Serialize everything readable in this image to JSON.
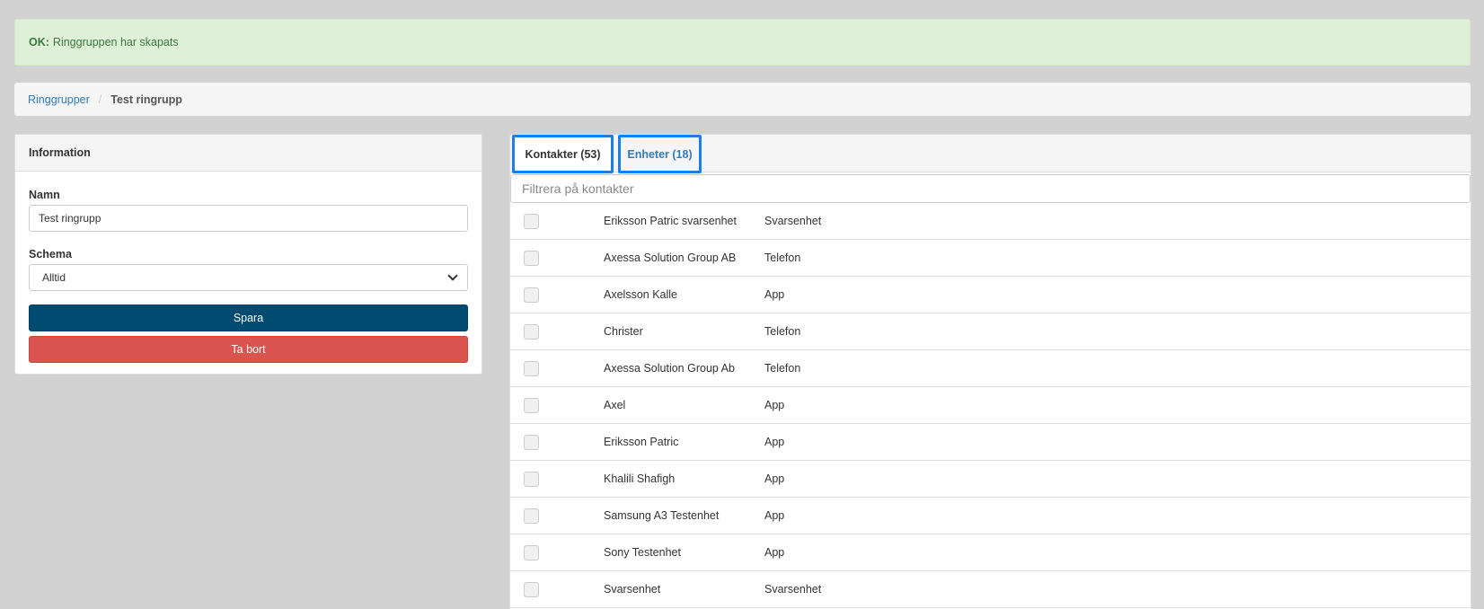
{
  "alert": {
    "prefix": "OK:",
    "message": "Ringgruppen har skapats"
  },
  "breadcrumb": {
    "parent": "Ringgrupper",
    "separator": "/",
    "current": "Test ringrupp"
  },
  "info_panel": {
    "title": "Information",
    "name_label": "Namn",
    "name_value": "Test ringrupp",
    "schedule_label": "Schema",
    "schedule_value": "Alltid",
    "save_label": "Spara",
    "delete_label": "Ta bort"
  },
  "tabs": [
    {
      "label": "Kontakter (53)",
      "active": true
    },
    {
      "label": "Enheter (18)",
      "active": false
    }
  ],
  "filter": {
    "placeholder": "Filtrera på kontakter"
  },
  "contacts": [
    {
      "name": "Eriksson Patric svarsenhet",
      "type": "Svarsenhet"
    },
    {
      "name": "Axessa Solution Group AB",
      "type": "Telefon"
    },
    {
      "name": "Axelsson Kalle",
      "type": "App"
    },
    {
      "name": "Christer",
      "type": "Telefon"
    },
    {
      "name": "Axessa Solution Group Ab",
      "type": "Telefon"
    },
    {
      "name": "Axel",
      "type": "App"
    },
    {
      "name": "Eriksson Patric",
      "type": "App"
    },
    {
      "name": "Khalili Shafigh",
      "type": "App"
    },
    {
      "name": "Samsung A3 Testenhet",
      "type": "App"
    },
    {
      "name": "Sony Testenhet",
      "type": "App"
    },
    {
      "name": "Svarsenhet",
      "type": "Svarsenhet"
    }
  ],
  "colors": {
    "alert_bg": "#dff0d8",
    "save": "#004b6f",
    "delete": "#d9534f",
    "link": "#337ab7",
    "tab_outline": "#1a7fe8"
  }
}
